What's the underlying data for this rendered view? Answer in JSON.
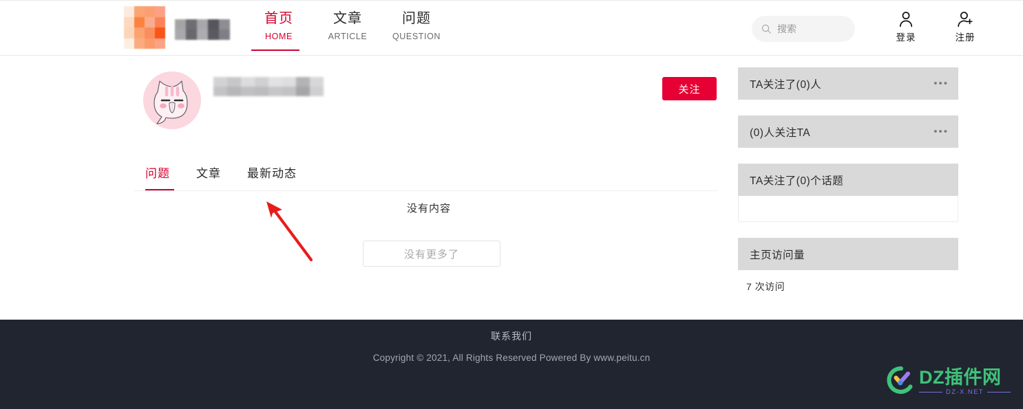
{
  "header": {
    "logo_alt": "site-logo",
    "brand_name_redacted": "",
    "nav": [
      {
        "cn": "首页",
        "en": "HOME",
        "active": true
      },
      {
        "cn": "文章",
        "en": "ARTICLE",
        "active": false
      },
      {
        "cn": "问题",
        "en": "QUESTION",
        "active": false
      }
    ],
    "search": {
      "placeholder": "搜索",
      "value": ""
    },
    "account": [
      {
        "label": "登录",
        "icon": "user-icon"
      },
      {
        "label": "注册",
        "icon": "user-plus-icon"
      }
    ]
  },
  "profile": {
    "avatar_alt": "pink-cat-avatar",
    "username_redacted": "",
    "follow_label": "关注"
  },
  "content": {
    "tabs": [
      {
        "label": "问题",
        "active": true
      },
      {
        "label": "文章",
        "active": false
      },
      {
        "label": "最新动态",
        "active": false
      }
    ],
    "empty_text": "没有内容",
    "no_more_label": "没有更多了"
  },
  "sidebar": {
    "cards": [
      {
        "title": "TA关注了(0)人",
        "menu": "•••",
        "has_body": false
      },
      {
        "title": "(0)人关注TA",
        "menu": "•••",
        "has_body": false
      },
      {
        "title": "TA关注了(0)个话题",
        "menu": "",
        "has_body": true
      },
      {
        "title": "主页访问量",
        "menu": "",
        "has_body": false,
        "note": "7 次访问"
      }
    ]
  },
  "footer": {
    "contact": "联系我们",
    "copyright": "Copyright © 2021, All Rights Reserved Powered By www.peitu.cn"
  },
  "watermark": {
    "main": "DZ插件网",
    "sub": "DZ-X.NET"
  },
  "colors": {
    "accent_red": "#d4002c",
    "follow_red": "#e60033",
    "footer_bg": "#212530",
    "card_head": "#d9d9d9",
    "watermark_green": "#3fc27a",
    "watermark_purple": "#7b6fe0",
    "annotation_red": "#e81c1c"
  }
}
